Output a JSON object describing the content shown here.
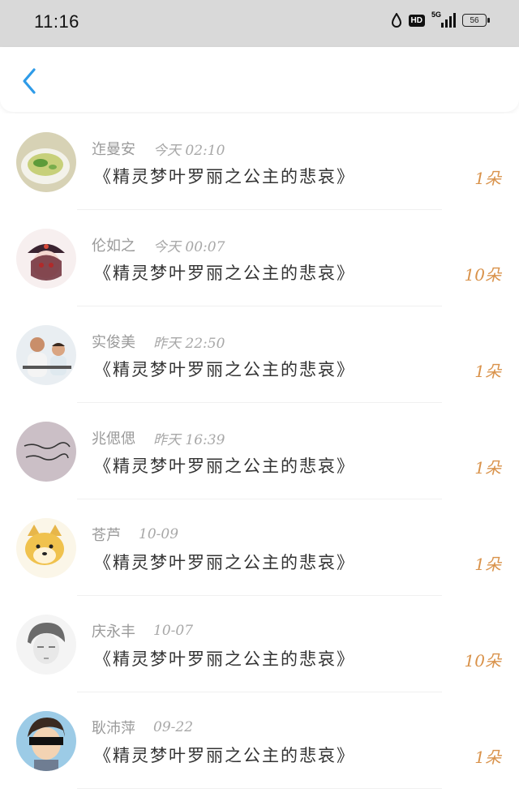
{
  "status_bar": {
    "time": "11:16",
    "network": "5G",
    "battery": "56"
  },
  "header": {
    "back_icon": "chevron-left-icon",
    "accent": "#2e9be8"
  },
  "messages": [
    {
      "name": "迮曼安",
      "time": "今天 02:10",
      "title": "《精灵梦叶罗丽之公主的悲哀》",
      "count": "1朵"
    },
    {
      "name": "伦如之",
      "time": "今天 00:07",
      "title": "《精灵梦叶罗丽之公主的悲哀》",
      "count": "10朵"
    },
    {
      "name": "实俊美",
      "time": "昨天 22:50",
      "title": "《精灵梦叶罗丽之公主的悲哀》",
      "count": "1朵"
    },
    {
      "name": "兆偲偲",
      "time": "昨天 16:39",
      "title": "《精灵梦叶罗丽之公主的悲哀》",
      "count": "1朵"
    },
    {
      "name": "苍芦",
      "time": "10-09",
      "title": "《精灵梦叶罗丽之公主的悲哀》",
      "count": "1朵"
    },
    {
      "name": "庆永丰",
      "time": "10-07",
      "title": "《精灵梦叶罗丽之公主的悲哀》",
      "count": "10朵"
    },
    {
      "name": "耿沛萍",
      "time": "09-22",
      "title": "《精灵梦叶罗丽之公主的悲哀》",
      "count": "1朵"
    }
  ]
}
